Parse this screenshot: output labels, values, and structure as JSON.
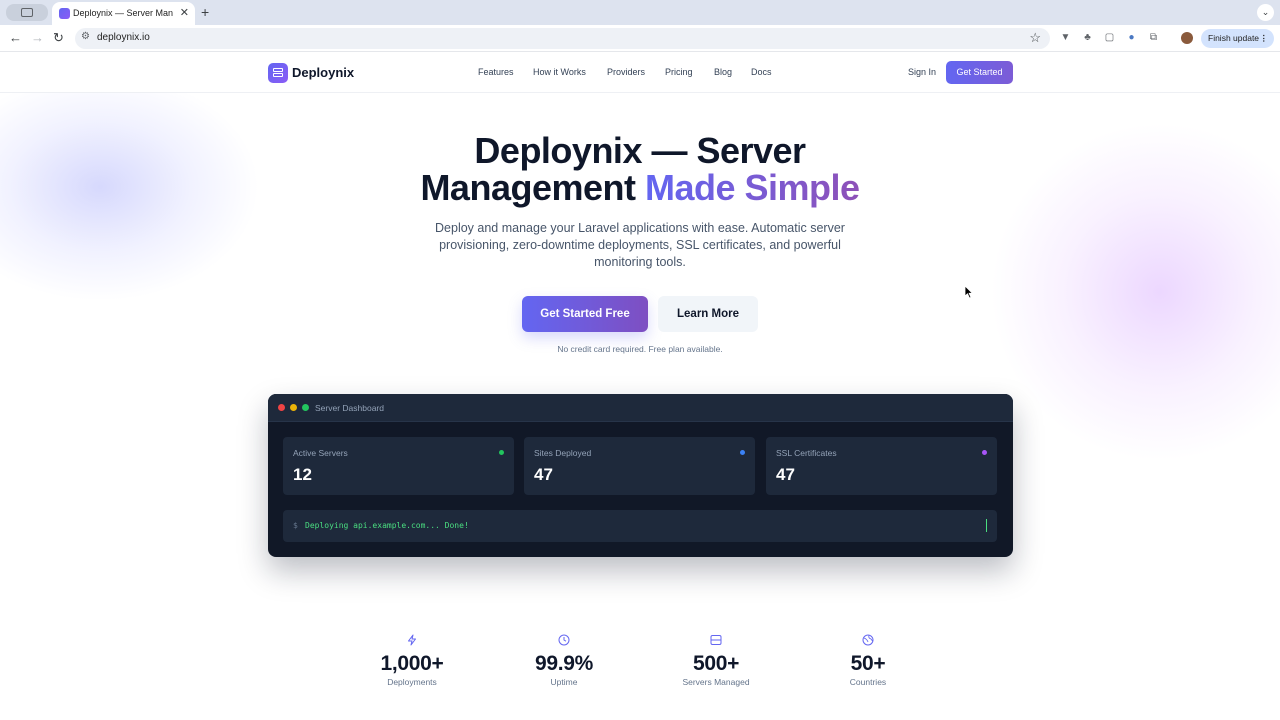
{
  "browser": {
    "tab_title": "Deploynix — Server Managem",
    "url": "deploynix.io",
    "finish_update": "Finish update"
  },
  "nav": {
    "brand": "Deploynix",
    "links": [
      "Features",
      "How it Works",
      "Providers",
      "Pricing",
      "Blog",
      "Docs"
    ],
    "sign_in": "Sign In",
    "cta": "Get Started"
  },
  "hero": {
    "title_line1": "Deploynix — Server",
    "title_line2a": "Management",
    "title_line2b": "Made Simple",
    "subtitle": "Deploy and manage your Laravel applications with ease. Automatic server provisioning, zero-downtime deployments, SSL certificates, and powerful monitoring tools.",
    "primary_button": "Get Started Free",
    "secondary_button": "Learn More",
    "note": "No credit card required. Free plan available."
  },
  "dashboard": {
    "title": "Server Dashboard",
    "cards": [
      {
        "label": "Active Servers",
        "value": "12",
        "color": "#22c55e"
      },
      {
        "label": "Sites Deployed",
        "value": "47",
        "color": "#3b82f6"
      },
      {
        "label": "SSL Certificates",
        "value": "47",
        "color": "#a855f7"
      }
    ],
    "terminal_prompt": "$",
    "terminal_text": "Deploying api.example.com... Done!"
  },
  "stats": [
    {
      "icon": "bolt-icon",
      "value": "1,000+",
      "label": "Deployments"
    },
    {
      "icon": "clock-icon",
      "value": "99.9%",
      "label": "Uptime"
    },
    {
      "icon": "server-icon",
      "value": "500+",
      "label": "Servers Managed"
    },
    {
      "icon": "globe-icon",
      "value": "50+",
      "label": "Countries"
    }
  ],
  "colors": {
    "accent": "#6366f1",
    "accent_end": "#8b5cf6",
    "dark_panel": "#111827"
  }
}
